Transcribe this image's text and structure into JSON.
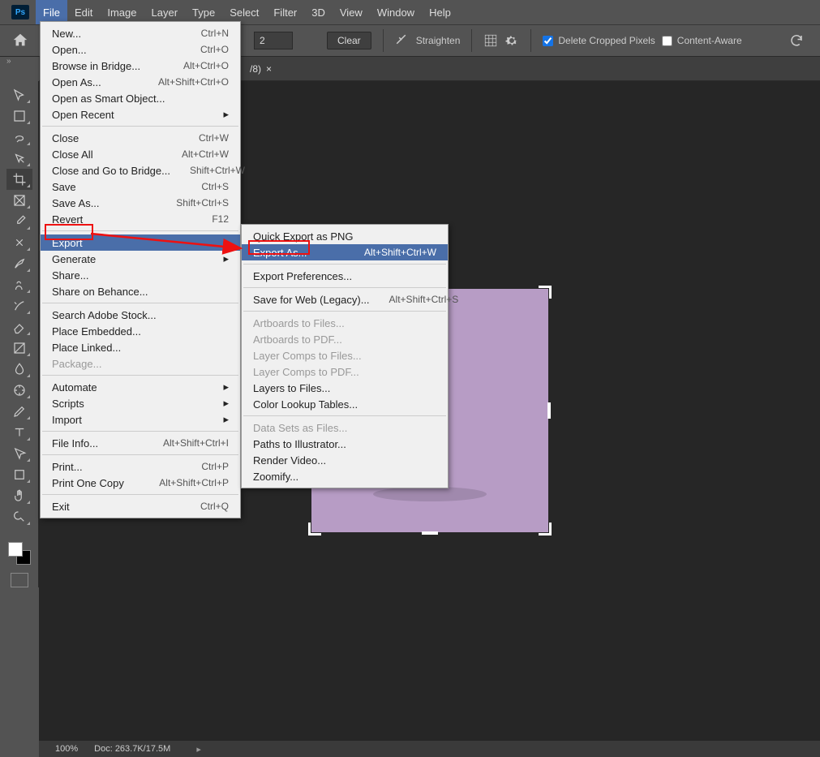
{
  "app": {
    "logo": "Ps"
  },
  "menubar": [
    "File",
    "Edit",
    "Image",
    "Layer",
    "Type",
    "Select",
    "Filter",
    "3D",
    "View",
    "Window",
    "Help"
  ],
  "menubar_open": "File",
  "optionsbar": {
    "ratio_value": "2",
    "clear": "Clear",
    "straighten": "Straighten",
    "delete_cropped": "Delete Cropped Pixels",
    "content_aware": "Content-Aware"
  },
  "doctab": {
    "label": "/8)",
    "close": "×"
  },
  "file_menu": [
    {
      "label": "New...",
      "short": "Ctrl+N"
    },
    {
      "label": "Open...",
      "short": "Ctrl+O"
    },
    {
      "label": "Browse in Bridge...",
      "short": "Alt+Ctrl+O"
    },
    {
      "label": "Open As...",
      "short": "Alt+Shift+Ctrl+O"
    },
    {
      "label": "Open as Smart Object..."
    },
    {
      "label": "Open Recent",
      "sub": true
    },
    {
      "sep": true
    },
    {
      "label": "Close",
      "short": "Ctrl+W"
    },
    {
      "label": "Close All",
      "short": "Alt+Ctrl+W"
    },
    {
      "label": "Close and Go to Bridge...",
      "short": "Shift+Ctrl+W"
    },
    {
      "label": "Save",
      "short": "Ctrl+S"
    },
    {
      "label": "Save As...",
      "short": "Shift+Ctrl+S"
    },
    {
      "label": "Revert",
      "short": "F12"
    },
    {
      "sep": true
    },
    {
      "label": "Export",
      "sub": true,
      "hl": true
    },
    {
      "label": "Generate",
      "sub": true
    },
    {
      "label": "Share..."
    },
    {
      "label": "Share on Behance..."
    },
    {
      "sep": true
    },
    {
      "label": "Search Adobe Stock..."
    },
    {
      "label": "Place Embedded..."
    },
    {
      "label": "Place Linked..."
    },
    {
      "label": "Package...",
      "disabled": true
    },
    {
      "sep": true
    },
    {
      "label": "Automate",
      "sub": true
    },
    {
      "label": "Scripts",
      "sub": true
    },
    {
      "label": "Import",
      "sub": true
    },
    {
      "sep": true
    },
    {
      "label": "File Info...",
      "short": "Alt+Shift+Ctrl+I"
    },
    {
      "sep": true
    },
    {
      "label": "Print...",
      "short": "Ctrl+P"
    },
    {
      "label": "Print One Copy",
      "short": "Alt+Shift+Ctrl+P"
    },
    {
      "sep": true
    },
    {
      "label": "Exit",
      "short": "Ctrl+Q"
    }
  ],
  "export_menu": [
    {
      "label": "Quick Export as PNG"
    },
    {
      "label": "Export As...",
      "short": "Alt+Shift+Ctrl+W",
      "hl": true
    },
    {
      "sep": true
    },
    {
      "label": "Export Preferences..."
    },
    {
      "sep": true
    },
    {
      "label": "Save for Web (Legacy)...",
      "short": "Alt+Shift+Ctrl+S"
    },
    {
      "sep": true
    },
    {
      "label": "Artboards to Files...",
      "disabled": true
    },
    {
      "label": "Artboards to PDF...",
      "disabled": true
    },
    {
      "label": "Layer Comps to Files...",
      "disabled": true
    },
    {
      "label": "Layer Comps to PDF...",
      "disabled": true
    },
    {
      "label": "Layers to Files..."
    },
    {
      "label": "Color Lookup Tables..."
    },
    {
      "sep": true
    },
    {
      "label": "Data Sets as Files...",
      "disabled": true
    },
    {
      "label": "Paths to Illustrator..."
    },
    {
      "label": "Render Video..."
    },
    {
      "label": "Zoomify..."
    }
  ],
  "tools": [
    {
      "id": "move"
    },
    {
      "id": "marquee"
    },
    {
      "id": "lasso"
    },
    {
      "id": "quick-select"
    },
    {
      "id": "crop",
      "sel": true
    },
    {
      "id": "frame"
    },
    {
      "id": "eyedropper"
    },
    {
      "id": "healing"
    },
    {
      "id": "brush"
    },
    {
      "id": "clone"
    },
    {
      "id": "history-brush"
    },
    {
      "id": "eraser"
    },
    {
      "id": "gradient"
    },
    {
      "id": "blur"
    },
    {
      "id": "dodge"
    },
    {
      "id": "pen"
    },
    {
      "id": "type"
    },
    {
      "id": "path-select"
    },
    {
      "id": "rectangle"
    },
    {
      "id": "hand"
    },
    {
      "id": "zoom"
    }
  ],
  "status": {
    "zoom": "100%",
    "doc": "Doc: 263.7K/17.5M"
  }
}
